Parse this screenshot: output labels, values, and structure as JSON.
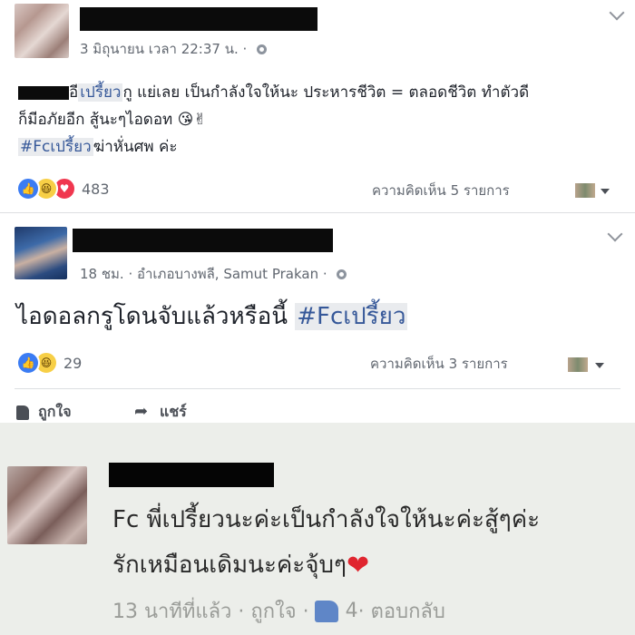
{
  "post1": {
    "timestamp": "3 มิถุนายน เวลา 22:37 น.",
    "privacy_sep": " · ",
    "line1_a": "อี",
    "line1_hashtag": "เปรี้ยว",
    "line1_b": "กู แย่เลย เป็นกำลังใจให้นะ ประหารชีวิต = ตลอดชีวิต ทำตัวดี",
    "line2": "ก็มีอภัยอีก สู้นะๆไอดอท",
    "line2_emoji": "😘✌",
    "line3_hashtag": "#Fcเปรี้ยว",
    "line3_rest": "ฆ่าหั่นศพ ค่ะ",
    "reaction_count": "483",
    "comments_count": "ความคิดเห็น 5 รายการ"
  },
  "post2": {
    "timestamp": "18 ชม. · อำเภอบางพลี, Samut Prakan · ",
    "text": "ไอดอลกรูโดนจับแล้วหรือนี้ ",
    "hashtag": "#Fcเปรี้ยว",
    "reaction_count": "29",
    "comments_count": "ความคิดเห็น 3 รายการ",
    "like_label": "ถูกใจ",
    "share_label": "แชร์"
  },
  "comment": {
    "line1": "Fc พี่เปรี้ยวนะค่ะเป็นกำลังใจให้นะค่ะสู้ๆค่ะ",
    "line2": "รักเหมือนเดิมนะค่ะจุ้บๆ",
    "heart": "❤",
    "time": "13 นาทีที่แล้ว · ถูกใจ · ",
    "likes": "4",
    "reply": " · ตอบกลับ"
  },
  "icons": [
    "like-icon",
    "haha-icon",
    "love-icon",
    "globe-icon",
    "chevron-down-icon",
    "thumbs-up-icon",
    "share-icon",
    "heart-icon"
  ]
}
